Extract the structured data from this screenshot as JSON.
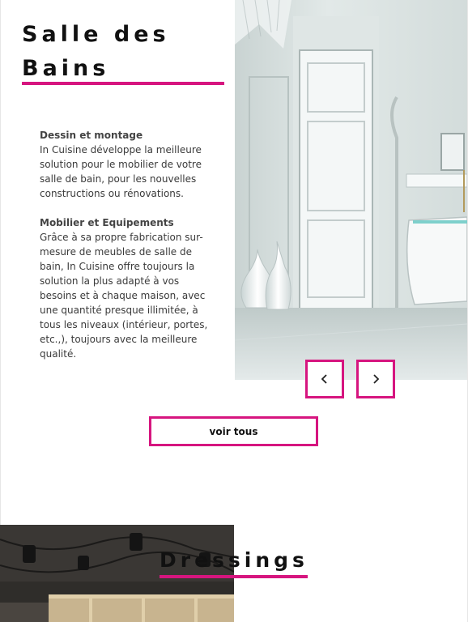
{
  "colors": {
    "accent": "#d6157f",
    "heading_text": "#111111",
    "body_text": "#3a3a3a"
  },
  "section_bains": {
    "title": "Salle des Bains",
    "blocks": [
      {
        "heading": "Dessin et montage",
        "text": "In Cuisine développe la meilleure solution pour le mobilier de votre salle de bain, pour les nouvelles constructions ou rénovations."
      },
      {
        "heading": "Mobilier et Equipements",
        "text": "Grâce à sa propre fabrication sur-mesure de meubles de salle de bain, In Cuisine offre toujours la solution la plus adapté à vos besoins et à chaque maison, avec une quantité presque illimitée, à tous les niveaux (intérieur, portes, etc.,), toujours avec la meilleure qualité."
      }
    ],
    "prev_icon": "chevron-left-icon",
    "next_icon": "chevron-right-icon",
    "cta_label": "voir tous"
  },
  "section_dressings": {
    "title": "Dressings"
  }
}
